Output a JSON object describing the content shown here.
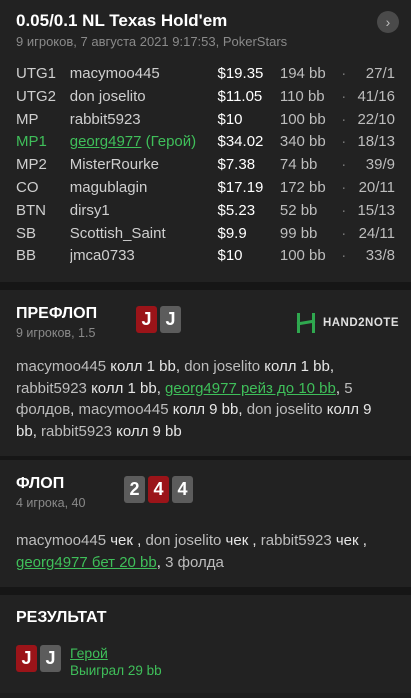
{
  "header": {
    "title": "0.05/0.1 NL Texas Hold'em",
    "subtitle": "9 игроков, 7 августа 2021 9:17:53, PokerStars",
    "nav_icon": "›"
  },
  "players": [
    {
      "pos": "UTG1",
      "name": "macymoo445",
      "suffix": "",
      "stack": "$19.35",
      "bb": "194 bb",
      "dot": "·",
      "stat": "27/1"
    },
    {
      "pos": "UTG2",
      "name": "don joselito",
      "suffix": "",
      "stack": "$11.05",
      "bb": "110 bb",
      "dot": "·",
      "stat": "41/16"
    },
    {
      "pos": "MP",
      "name": "rabbit5923",
      "suffix": "",
      "stack": "$10",
      "bb": "100 bb",
      "dot": "·",
      "stat": "22/10"
    },
    {
      "pos": "MP1",
      "name": "georg4977",
      "suffix": " (Герой)",
      "stack": "$34.02",
      "bb": "340 bb",
      "dot": "·",
      "stat": "18/13"
    },
    {
      "pos": "MP2",
      "name": "MisterRourke",
      "suffix": "",
      "stack": "$7.38",
      "bb": "74 bb",
      "dot": "·",
      "stat": "39/9"
    },
    {
      "pos": "CO",
      "name": "magublagin",
      "suffix": "",
      "stack": "$17.19",
      "bb": "172 bb",
      "dot": "·",
      "stat": "20/11"
    },
    {
      "pos": "BTN",
      "name": "dirsy1",
      "suffix": "",
      "stack": "$5.23",
      "bb": "52 bb",
      "dot": "·",
      "stat": "15/13"
    },
    {
      "pos": "SB",
      "name": "Scottish_Saint",
      "suffix": "",
      "stack": "$9.9",
      "bb": "99 bb",
      "dot": "·",
      "stat": "24/11"
    },
    {
      "pos": "BB",
      "name": "jmca0733",
      "suffix": "",
      "stack": "$10",
      "bb": "100 bb",
      "dot": "·",
      "stat": "33/8"
    }
  ],
  "preflop": {
    "title": "ПРЕФЛОП",
    "sub": "9 игроков, 1.5",
    "cards": [
      "J",
      "J"
    ],
    "logo_text": "HAND2NOTE",
    "actions": [
      {
        "player": "macymoo445",
        "action": "колл 1 bb"
      },
      {
        "player": "don joselito",
        "action": "колл 1 bb"
      },
      {
        "player": "rabbit5923",
        "action": "колл 1 bb"
      },
      {
        "hero": "georg4977 рейз до 10 bb"
      },
      {
        "text": "5 фолдов"
      },
      {
        "player": "macymoo445",
        "action": "колл 9 bb"
      },
      {
        "player": "don joselito",
        "action": "колл 9 bb"
      },
      {
        "player": "rabbit5923",
        "action": "колл 9 bb"
      }
    ]
  },
  "flop": {
    "title": "ФЛОП",
    "sub": "4 игрока, 40",
    "cards": [
      {
        "rank": "2",
        "color": "gray"
      },
      {
        "rank": "4",
        "color": "red"
      },
      {
        "rank": "4",
        "color": "gray"
      }
    ],
    "actions": [
      {
        "player": "macymoo445",
        "action": "чек"
      },
      {
        "player": "don joselito",
        "action": "чек"
      },
      {
        "player": "rabbit5923",
        "action": "чек"
      },
      {
        "hero": "georg4977 бет 20 bb"
      },
      {
        "text": "3 фолда"
      }
    ]
  },
  "result": {
    "title": "РЕЗУЛЬТАТ",
    "cards": [
      {
        "rank": "J",
        "color": "red"
      },
      {
        "rank": "J",
        "color": "gray"
      }
    ],
    "hero_label": "Герой",
    "won_text": "Выиграл 29 bb"
  },
  "colors": {
    "hero_green": "#3fbf5a",
    "card_red": "#9b1419",
    "card_gray": "#5c5c5c",
    "background": "#1e1e1e"
  }
}
